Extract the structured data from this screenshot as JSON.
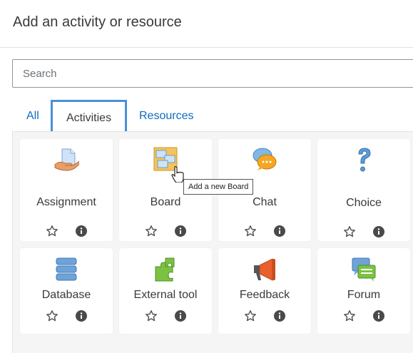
{
  "dialog": {
    "title": "Add an activity or resource"
  },
  "search": {
    "placeholder": "Search"
  },
  "tabs": [
    {
      "label": "All",
      "selected": false
    },
    {
      "label": "Activities",
      "selected": true
    },
    {
      "label": "Resources",
      "selected": false
    }
  ],
  "tooltip": {
    "text": "Add a new Board"
  },
  "modules": [
    {
      "label": "Assignment",
      "icon": "assignment-icon"
    },
    {
      "label": "Board",
      "icon": "board-icon"
    },
    {
      "label": "Chat",
      "icon": "chat-icon"
    },
    {
      "label": "Choice",
      "icon": "choice-icon"
    },
    {
      "label": "Database",
      "icon": "database-icon"
    },
    {
      "label": "External tool",
      "icon": "external-tool-icon"
    },
    {
      "label": "Feedback",
      "icon": "feedback-icon"
    },
    {
      "label": "Forum",
      "icon": "forum-icon"
    }
  ],
  "colors": {
    "link": "#0f6cbf",
    "tab_outline": "#4a90d9",
    "panel_bg": "#f5f5f5"
  }
}
